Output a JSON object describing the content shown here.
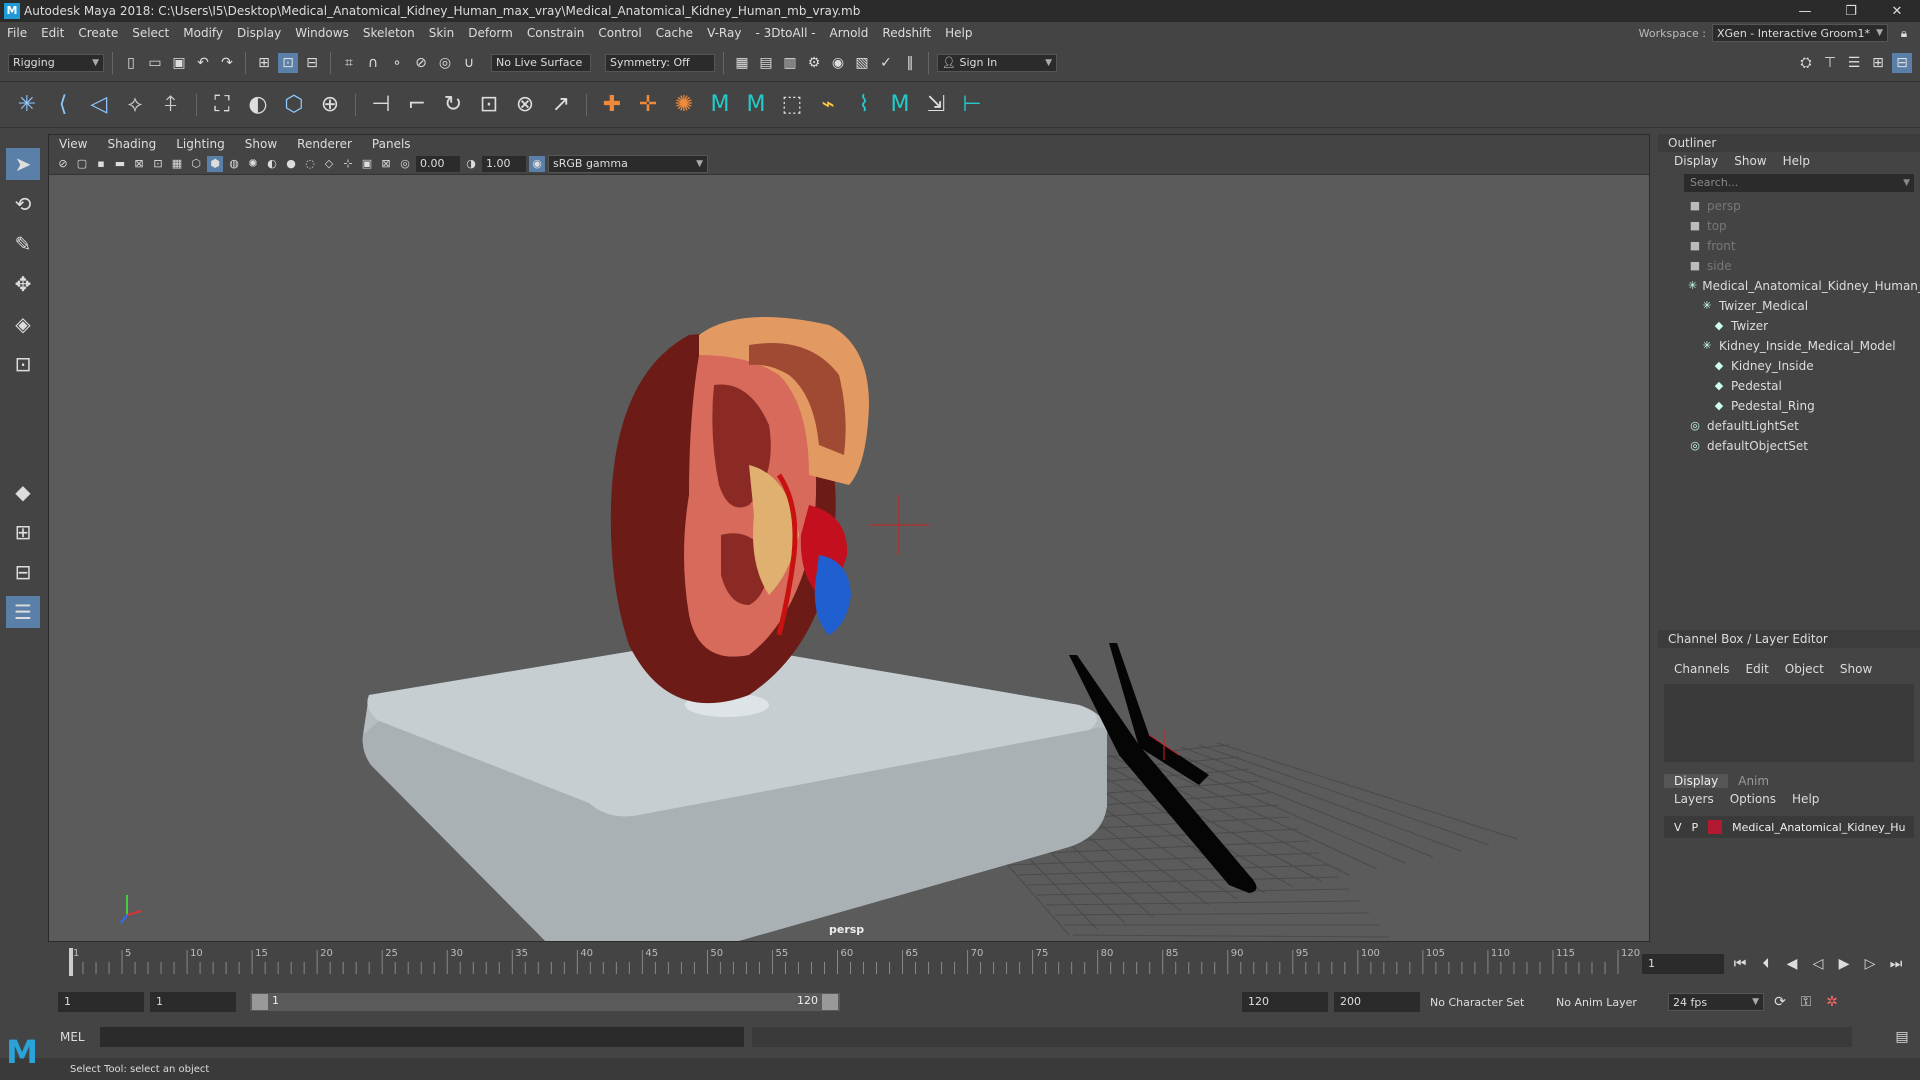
{
  "app": {
    "title": "Autodesk Maya 2018: C:\\Users\\I5\\Desktop\\Medical_Anatomical_Kidney_Human_max_vray\\Medical_Anatomical_Kidney_Human_mb_vray.mb",
    "window_buttons": [
      "—",
      "❐",
      "✕"
    ]
  },
  "menubar": {
    "items": [
      "File",
      "Edit",
      "Create",
      "Select",
      "Modify",
      "Display",
      "Windows",
      "Skeleton",
      "Skin",
      "Deform",
      "Constrain",
      "Control",
      "Cache",
      "V-Ray",
      "- 3DtoAll -",
      "Arnold",
      "Redshift",
      "Help"
    ],
    "workspace_label": "Workspace :",
    "workspace_value": "XGen - Interactive Groom1*"
  },
  "statusline": {
    "mode": "Rigging",
    "live_surface": "No Live Surface",
    "symmetry": "Symmetry: Off",
    "sign_in": "Sign In"
  },
  "viewport": {
    "menu": [
      "View",
      "Shading",
      "Lighting",
      "Show",
      "Renderer",
      "Panels"
    ],
    "exposure": "0.00",
    "gamma": "1.00",
    "color_space": "sRGB gamma",
    "camera": "persp"
  },
  "outliner": {
    "title": "Outliner",
    "menu": [
      "Display",
      "Show",
      "Help"
    ],
    "search_placeholder": "Search...",
    "nodes": [
      {
        "label": "persp",
        "depth": 0,
        "type": "camera",
        "dim": true
      },
      {
        "label": "top",
        "depth": 0,
        "type": "camera",
        "dim": true
      },
      {
        "label": "front",
        "depth": 0,
        "type": "camera",
        "dim": true
      },
      {
        "label": "side",
        "depth": 0,
        "type": "camera",
        "dim": true
      },
      {
        "label": "Medical_Anatomical_Kidney_Human_r",
        "depth": 0,
        "type": "group",
        "dim": false
      },
      {
        "label": "Twizer_Medical",
        "depth": 1,
        "type": "group",
        "dim": false
      },
      {
        "label": "Twizer",
        "depth": 2,
        "type": "mesh",
        "dim": false
      },
      {
        "label": "Kidney_Inside_Medical_Model",
        "depth": 1,
        "type": "group",
        "dim": false
      },
      {
        "label": "Kidney_Inside",
        "depth": 2,
        "type": "mesh",
        "dim": false
      },
      {
        "label": "Pedestal",
        "depth": 2,
        "type": "mesh",
        "dim": false
      },
      {
        "label": "Pedestal_Ring",
        "depth": 2,
        "type": "mesh",
        "dim": false
      },
      {
        "label": "defaultLightSet",
        "depth": 0,
        "type": "set",
        "dim": false
      },
      {
        "label": "defaultObjectSet",
        "depth": 0,
        "type": "set",
        "dim": false
      }
    ]
  },
  "channelbox": {
    "title": "Channel Box / Layer Editor",
    "menu": [
      "Channels",
      "Edit",
      "Object",
      "Show"
    ],
    "tabs": [
      "Display",
      "Anim"
    ],
    "layer_menu": [
      "Layers",
      "Options",
      "Help"
    ],
    "layer": {
      "v": "V",
      "p": "P",
      "name": "Medical_Anatomical_Kidney_Hu",
      "color": "#b21a32"
    }
  },
  "timeline": {
    "ticks": [
      "1",
      "5",
      "10",
      "15",
      "20",
      "25",
      "30",
      "35",
      "40",
      "45",
      "50",
      "55",
      "60",
      "65",
      "70",
      "75",
      "80",
      "85",
      "90",
      "95",
      "100",
      "105",
      "110",
      "115",
      "120"
    ],
    "current_frame": "1"
  },
  "range": {
    "start": "1",
    "start2": "1",
    "slider_start": "1",
    "slider_end": "120",
    "end": "120",
    "end2": "200",
    "character_set": "No Character Set",
    "anim_layer": "No Anim Layer",
    "fps": "24 fps"
  },
  "cmd": {
    "lang": "MEL"
  },
  "status": {
    "help": "Select Tool: select an object"
  }
}
